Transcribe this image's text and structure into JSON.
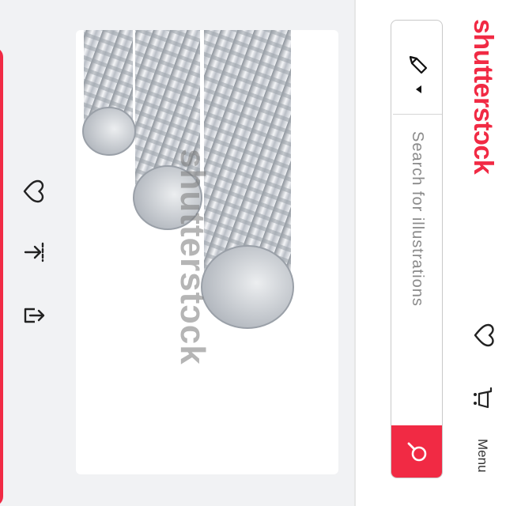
{
  "brand": {
    "logo_text": "shutterstɔck",
    "color": "#f12a44"
  },
  "header": {
    "menu_label": "Menu",
    "icons": [
      "heart-icon",
      "cart-icon"
    ]
  },
  "search": {
    "type_icon": "pen-icon",
    "placeholder": "Search for illustrations",
    "value": "",
    "button_icon": "search-icon"
  },
  "image": {
    "watermark": "shutterstɔck",
    "subject_icon": "steel-rebar-image"
  },
  "actions": [
    {
      "icon": "heart-icon"
    },
    {
      "icon": "collapse-icon"
    },
    {
      "icon": "share-icon"
    }
  ],
  "colors": {
    "accent": "#f12a44",
    "background": "#f1f2f4"
  }
}
